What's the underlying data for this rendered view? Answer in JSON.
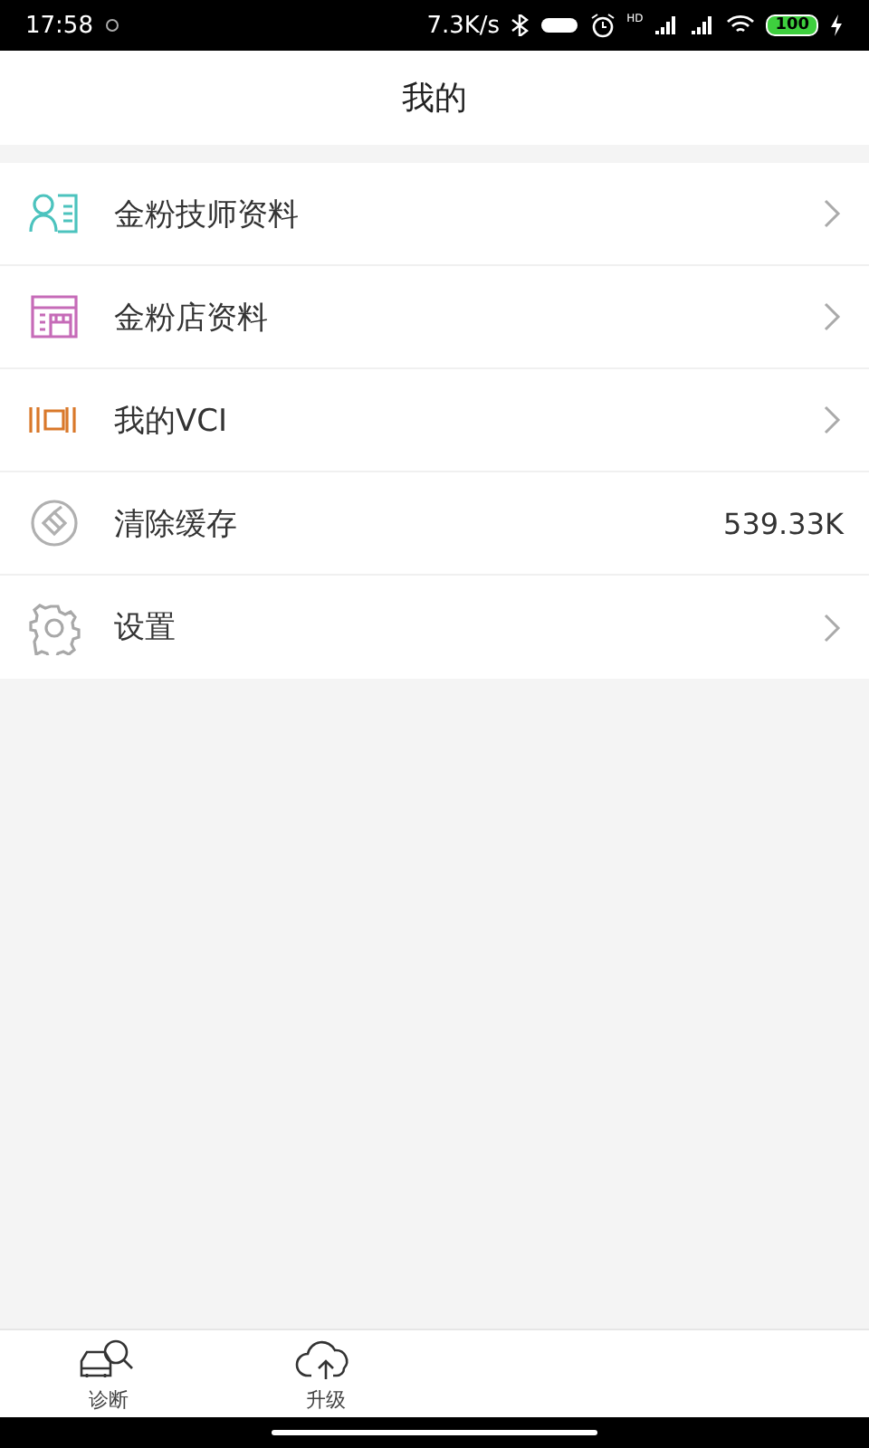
{
  "status_bar": {
    "time": "17:58",
    "speed": "7.3K/s",
    "hd": "HD",
    "battery": "100"
  },
  "header": {
    "title": "我的"
  },
  "menu": [
    {
      "label": "金粉技师资料",
      "kind": "link",
      "color": "#4cc3be"
    },
    {
      "label": "金粉店资料",
      "kind": "link",
      "color": "#c66bb8"
    },
    {
      "label": "我的VCI",
      "kind": "link",
      "color": "#d9782a"
    },
    {
      "label": "清除缓存",
      "kind": "value",
      "value": "539.33K",
      "color": "#b0b0b0"
    },
    {
      "label": "设置",
      "kind": "link",
      "color": "#a8a8a8"
    }
  ],
  "tab_bar": [
    {
      "label": "诊断"
    },
    {
      "label": "升级"
    }
  ]
}
